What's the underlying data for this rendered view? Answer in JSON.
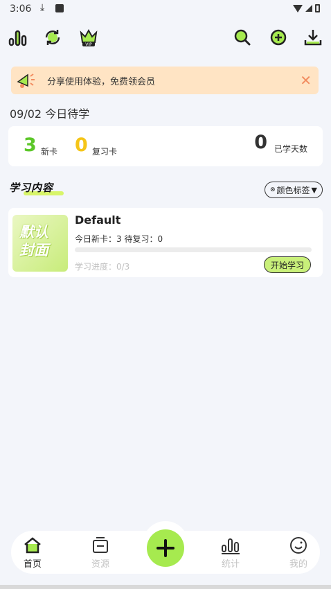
{
  "status_bar": {
    "time": "3:06"
  },
  "banner": {
    "text": "分享使用体验，免费领会员",
    "close": "✕"
  },
  "date_line": "09/02 今日待学",
  "stats": {
    "new_count": "3",
    "new_label": "新卡",
    "review_count": "0",
    "review_label": "复习卡",
    "days_count": "0",
    "days_label": "已学天数"
  },
  "section": {
    "title": "学习内容",
    "color_tag_label": "颜色标签"
  },
  "deck": {
    "cover_text": "默认封面",
    "title": "Default",
    "info": "今日新卡：3 待复习：0",
    "progress_label": "学习进度：0/3",
    "progress_fraction": 0,
    "study_button": "开始学习"
  },
  "nav": {
    "items": [
      {
        "label": "首页"
      },
      {
        "label": "资源"
      },
      {
        "label": "统计"
      },
      {
        "label": "我的"
      }
    ],
    "active_color": "#222222",
    "inactive_color": "#c4c4c4"
  },
  "colors": {
    "accent_green": "#a6ea4f",
    "new_green": "#5cc729",
    "review_yellow": "#f5c518",
    "banner_bg": "#ffe4c4"
  },
  "icons": [
    "stats-icon",
    "sync-icon",
    "vip-icon",
    "search-icon",
    "add-circle-icon",
    "download-icon",
    "megaphone-icon",
    "home-icon",
    "resources-icon",
    "plus-icon",
    "statistics-icon",
    "profile-icon"
  ]
}
